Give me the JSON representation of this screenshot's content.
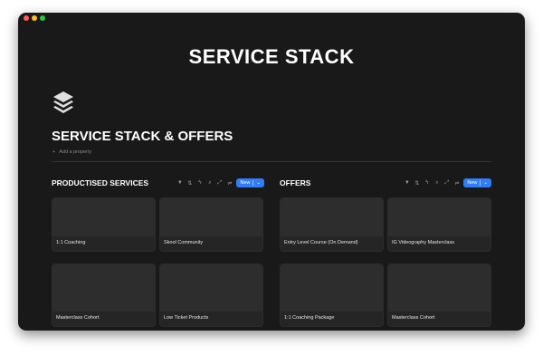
{
  "banner": {
    "title": "SERVICE STACK"
  },
  "page": {
    "icon": "stack-layers-icon",
    "title": "SERVICE STACK & OFFERS",
    "add_property": "Add a property"
  },
  "sections": [
    {
      "title": "PRODUCTISED SERVICES",
      "new_label": "New",
      "cards": [
        "1:1 Coaching",
        "Skool Community",
        "Masterclass Cohort",
        "Low Ticket Products"
      ]
    },
    {
      "title": "OFFERS",
      "new_label": "New",
      "cards": [
        "Entry Level Course (On Demand)",
        "IG Videography Masterclass",
        "1:1 Coaching Package",
        "Masterclass Cohort"
      ]
    }
  ],
  "colors": {
    "accent": "#2f7ef5",
    "background": "#191919",
    "card": "#252525"
  }
}
